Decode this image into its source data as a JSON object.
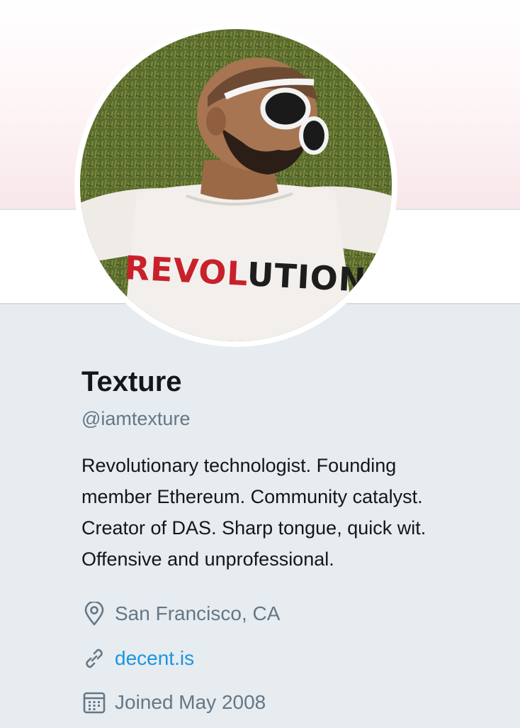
{
  "profile": {
    "name": "Texture",
    "handle": "@iamtexture",
    "bio": "Revolutionary technologist. Founding\nmember Ethereum. Community catalyst.\nCreator of DAS. Sharp tongue, quick wit.\nOffensive and unprofessional.",
    "location": "San Francisco, CA",
    "website": "decent.is",
    "joined": "Joined May 2008",
    "avatar_shirt_text": "REVOLUTIONARY"
  },
  "icons": {
    "location": "map-pin-icon",
    "website": "link-icon",
    "joined": "calendar-icon"
  },
  "colors": {
    "name": "#14171a",
    "secondary_text": "#657786",
    "link": "#1b95e0",
    "background": "#e6ecf0"
  }
}
